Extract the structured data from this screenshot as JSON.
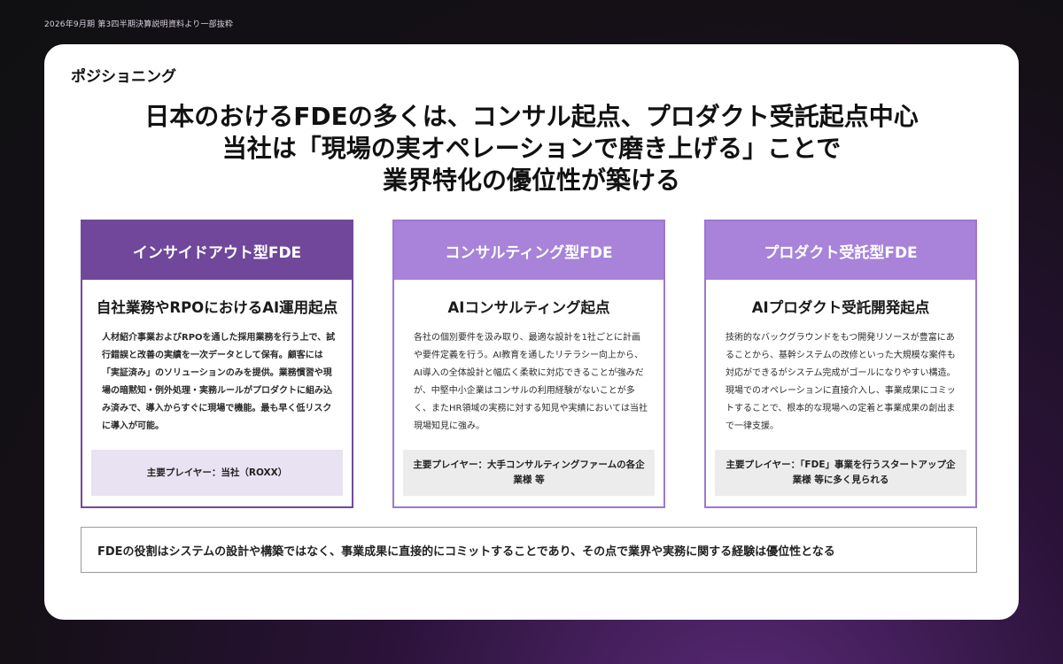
{
  "top_note": "2026年9月期 第3四半期決算説明資料より一部抜粋",
  "section_label": "ポジショニング",
  "headline": {
    "line1": "日本のおけるFDEの多くは、コンサル起点、プロダクト受託起点中心",
    "line2": "当社は「現場の実オペレーションで磨き上げる」ことで",
    "line3": "業界特化の優位性が築ける"
  },
  "cards": [
    {
      "title": "インサイドアウト型FDE",
      "subtitle": "自社業務やRPOにおけるAI運用起点",
      "body": "人材紹介事業およびRPOを通した採用業務を行う上で、試行錯誤と改善の実績を一次データとして保有。顧客には「実証済み」のソリューションのみを提供。業務慣習や現場の暗黙知・例外処理・実務ルールがプロダクトに組み込み済みで、導入からすぐに現場で機能。最も早く低リスクに導入が可能。",
      "players": "主要プレイヤー：当社（ROXX）"
    },
    {
      "title": "コンサルティング型FDE",
      "subtitle": "AIコンサルティング起点",
      "body": "各社の個別要件を汲み取り、最適な設計を1社ごとに計画や要件定義を行う。AI教育を通したリテラシー向上から、AI導入の全体設計と幅広く柔軟に対応できることが強みだが、中堅中小企業はコンサルの利用経験がないことが多く、またHR領域の実務に対する知見や実績においては当社現場知見に強み。",
      "players": "主要プレイヤー：大手コンサルティングファームの各企業様 等"
    },
    {
      "title": "プロダクト受託型FDE",
      "subtitle": "AIプロダクト受託開発起点",
      "body": "技術的なバックグラウンドをもつ開発リソースが豊富にあることから、基幹システムの改修といった大規模な案件も対応ができるがシステム完成がゴールになりやすい構造。現場でのオペレーションに直接介入し、事業成果にコミットすることで、根本的な現場への定着と事業成果の創出まで一律支援。",
      "players": "主要プレイヤー：「FDE」事業を行うスタートアップ企業様 等に多く見られる"
    }
  ],
  "bottom_note": "FDEの役割はシステムの設計や構築ではなく、事業成果に直接的にコミットすることであり、その点で業界や実務に関する経験は優位性となる"
}
